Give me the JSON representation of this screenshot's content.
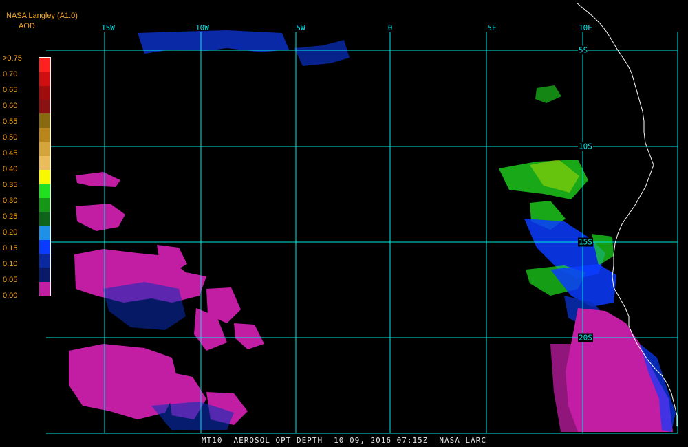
{
  "header": {
    "title": "NASA Langley (A1.0)",
    "subtitle": "AOD"
  },
  "legend": {
    "labels": [
      ">0.75",
      "0.70",
      "0.65",
      "0.60",
      "0.55",
      "0.50",
      "0.45",
      "0.40",
      "0.35",
      "0.30",
      "0.25",
      "0.20",
      "0.15",
      "0.10",
      "0.05",
      "0.00"
    ],
    "colors": [
      "#ff2020",
      "#d01010",
      "#a00c0c",
      "#8a1212",
      "#8a6a10",
      "#b8861a",
      "#d5a43a",
      "#eabc5a",
      "#f8f800",
      "#20e020",
      "#169616",
      "#0e6418",
      "#1e90e8",
      "#0a3cff",
      "#0a28a0",
      "#081a68",
      "#c21ea4"
    ]
  },
  "lon_labels": [
    "15W",
    "10W",
    "5W",
    "0",
    "5E",
    "10E"
  ],
  "lat_labels": [
    "5S",
    "10S",
    "15S",
    "20S"
  ],
  "footer": {
    "product": "MT10",
    "name": "AEROSOL OPT DEPTH",
    "datetime": "10 09, 2016 07:15Z",
    "source": "NASA LARC"
  },
  "colors": {
    "grid": "#00e6e6",
    "coast": "#ffffff",
    "header": "#f5a623",
    "aod_low": "#c21ea4",
    "aod_blue": "#0a3cff",
    "aod_green": "#20e020"
  }
}
